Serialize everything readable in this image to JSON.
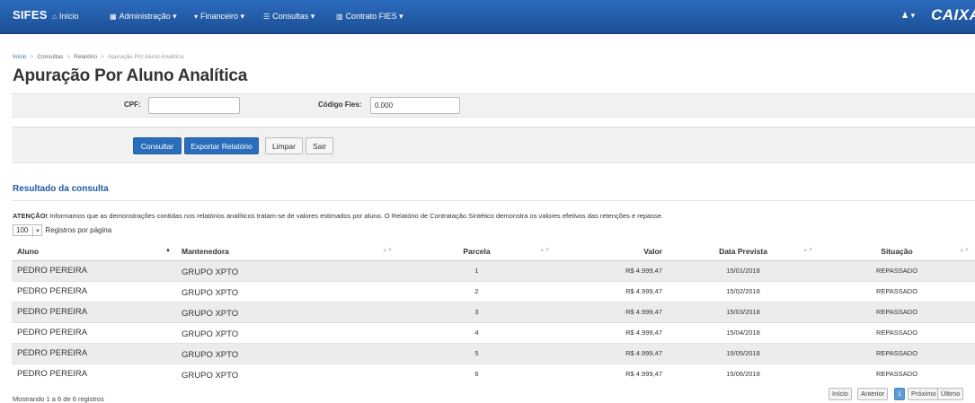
{
  "navbar": {
    "brand": "SIFES",
    "items": [
      {
        "icon": "home-icon",
        "glyph": "⌂",
        "label": "Início"
      },
      {
        "icon": "grid-icon",
        "glyph": "▦",
        "label": "Administração ▾"
      },
      {
        "icon": "cart-icon",
        "glyph": "▾",
        "label": "Financeiro ▾"
      },
      {
        "icon": "list-icon",
        "glyph": "☰",
        "label": "Consultas ▾"
      },
      {
        "icon": "bars-icon",
        "glyph": "▥",
        "label": "Contrato FIES ▾"
      }
    ],
    "user_menu": "▾",
    "logo": "CAIXA"
  },
  "breadcrumb": {
    "home": "Início",
    "consultas": "Consultas",
    "relatorio": "Relatório",
    "current": "Apuração Por Aluno Analítica"
  },
  "page": {
    "title": "Apuração Por Aluno Analítica"
  },
  "filters": {
    "cpf_label": "CPF:",
    "cpf_value": "",
    "codigo_label": "Código Fies:",
    "codigo_value": "0.000"
  },
  "actions": {
    "consultar": "Consultar",
    "exportar": "Exportar Relatório",
    "limpar": "Limpar",
    "sair": "Sair"
  },
  "results": {
    "title": "Resultado da consulta",
    "notice_strong": "ATENÇÃO!",
    "notice_text": " Informamos que as demonstrações contidas nos relatórios analíticos tratam-se de valores estimados por aluno. O Relatório de Contratação Sintético demonstra os valores efetivos das retenções e repasse.",
    "per_page_value": "100",
    "per_page_label": "Registros por página",
    "columns": {
      "aluno": "Aluno",
      "mantenedora": "Mantenedora",
      "parcela": "Parcela",
      "valor": "Valor",
      "data": "Data Prevista",
      "situacao": "Situação"
    },
    "rows": [
      {
        "aluno": "PEDRO PEREIRA",
        "mantenedora": "GRUPO XPTO",
        "parcela": "1",
        "valor": "R$ 4.999,47",
        "data": "15/01/2018",
        "situacao": "REPASSADO"
      },
      {
        "aluno": "PEDRO PEREIRA",
        "mantenedora": "GRUPO XPTO",
        "parcela": "2",
        "valor": "R$ 4.999,47",
        "data": "15/02/2018",
        "situacao": "REPASSADO"
      },
      {
        "aluno": "PEDRO PEREIRA",
        "mantenedora": "GRUPO XPTO",
        "parcela": "3",
        "valor": "R$ 4.999,47",
        "data": "15/03/2018",
        "situacao": "REPASSADO"
      },
      {
        "aluno": "PEDRO PEREIRA",
        "mantenedora": "GRUPO XPTO",
        "parcela": "4",
        "valor": "R$ 4.999,47",
        "data": "15/04/2018",
        "situacao": "REPASSADO"
      },
      {
        "aluno": "PEDRO PEREIRA",
        "mantenedora": "GRUPO XPTO",
        "parcela": "5",
        "valor": "R$ 4.999,47",
        "data": "15/05/2018",
        "situacao": "REPASSADO"
      },
      {
        "aluno": "PEDRO PEREIRA",
        "mantenedora": "GRUPO XPTO",
        "parcela": "6",
        "valor": "R$ 4.999,47",
        "data": "15/06/2018",
        "situacao": "REPASSADO"
      }
    ],
    "footer_info": "Mostrando 1 a 6 de 6 registros",
    "pagination": {
      "first": "Início",
      "prev": "Anterior",
      "current": "1",
      "next": "Próximo",
      "last": "Último"
    }
  }
}
